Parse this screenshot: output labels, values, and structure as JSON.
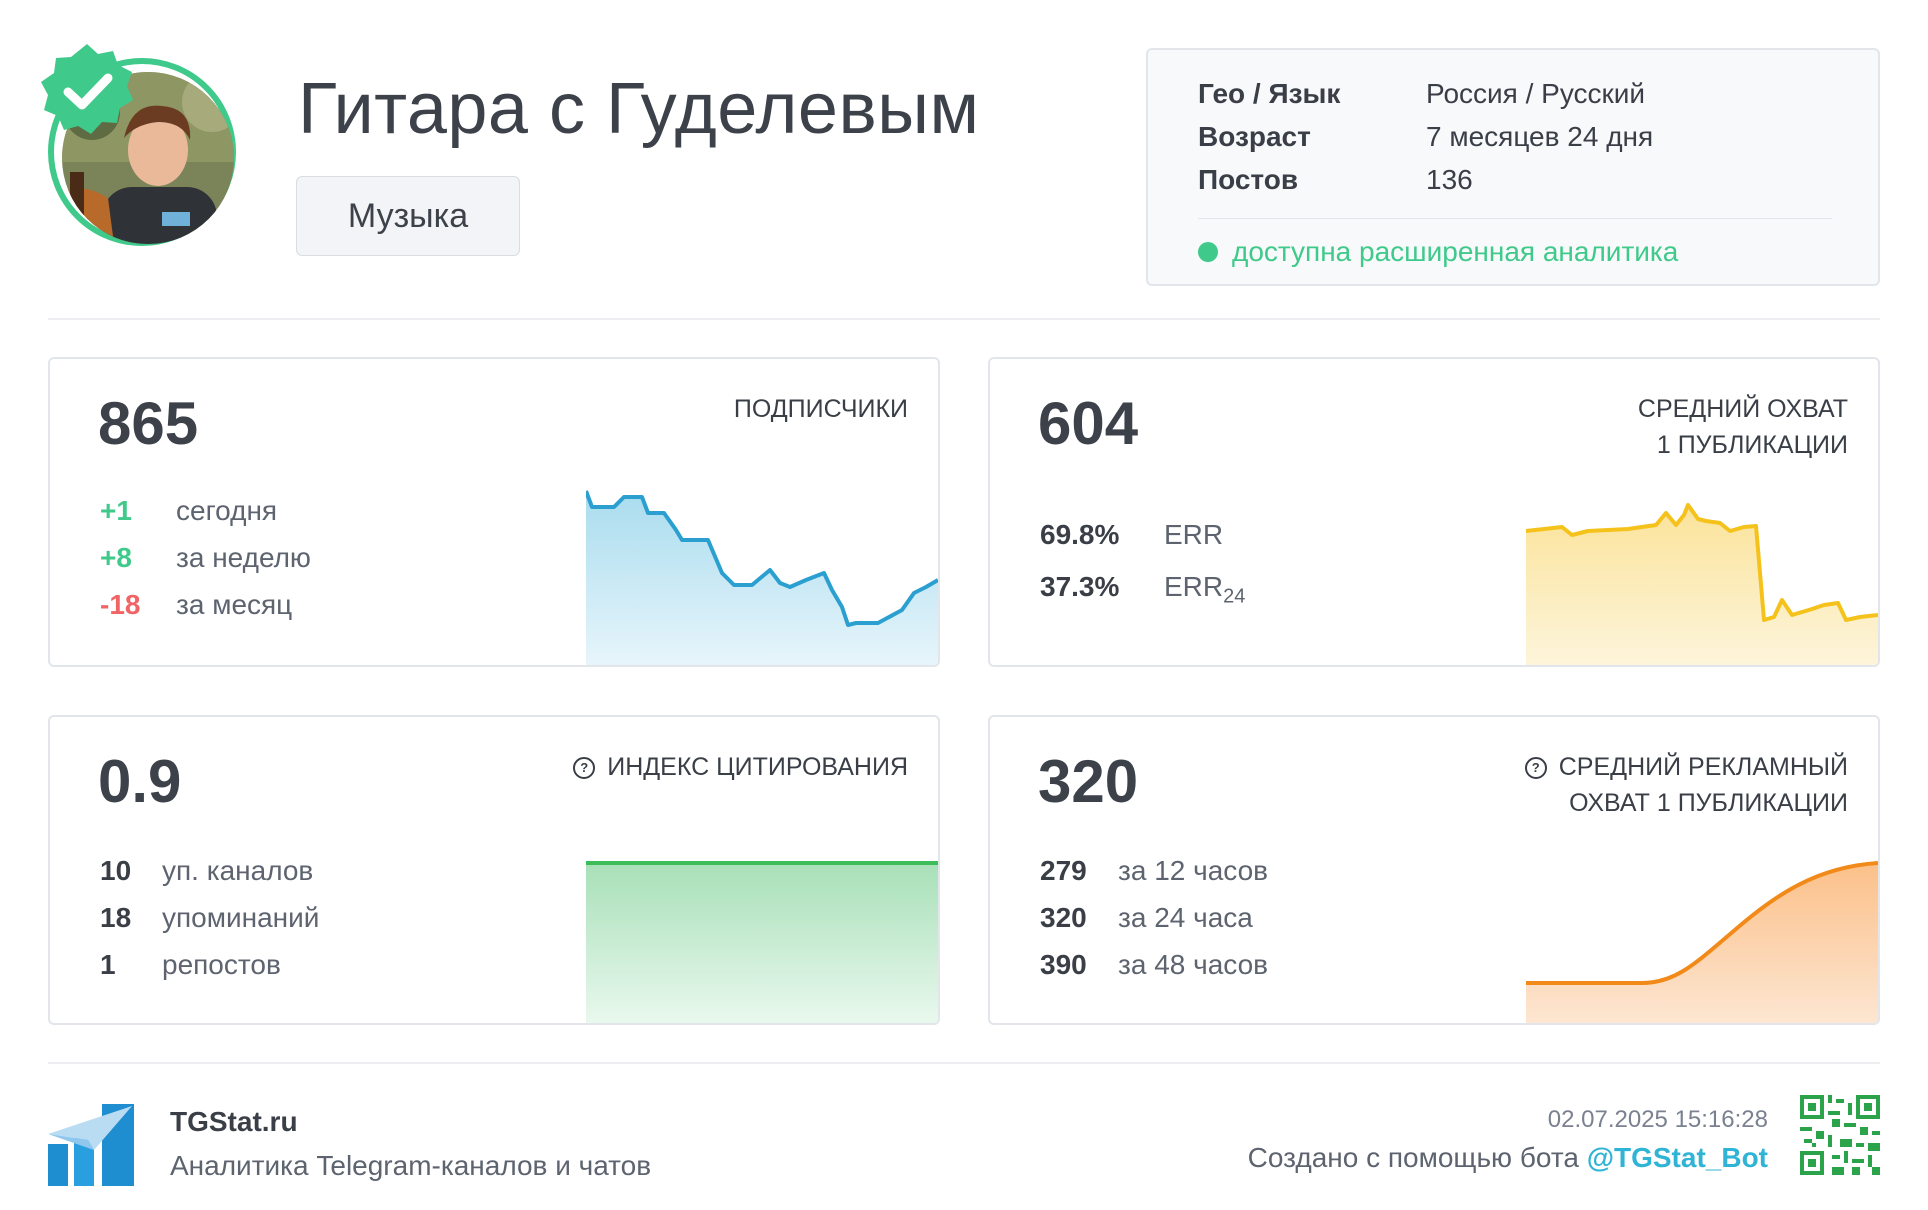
{
  "header": {
    "title": "Гитара с Гуделевым",
    "category": "Музыка"
  },
  "info": {
    "rows": [
      {
        "key": "Гео / Язык",
        "value": "Россия / Русский"
      },
      {
        "key": "Возраст",
        "value": "7 месяцев 24 дня"
      },
      {
        "key": "Постов",
        "value": "136"
      }
    ],
    "analytics": "доступна расширенная аналитика"
  },
  "subscribers": {
    "value": "865",
    "label": "ПОДПИСЧИКИ",
    "today": {
      "n": "+1",
      "t": "сегодня"
    },
    "week": {
      "n": "+8",
      "t": "за неделю"
    },
    "month": {
      "n": "-18",
      "t": "за месяц"
    }
  },
  "reach": {
    "value": "604",
    "label_line1": "СРЕДНИЙ ОХВАТ",
    "label_line2": "1 ПУБЛИКАЦИИ",
    "err": {
      "n": "69.8%",
      "t": "ERR"
    },
    "err24": {
      "n": "37.3%",
      "t": "ERR",
      "sub": "24"
    }
  },
  "citation": {
    "value": "0.9",
    "label": "ИНДЕКС ЦИТИРОВАНИЯ",
    "channels": {
      "n": "10",
      "t": "уп. каналов"
    },
    "mentions": {
      "n": "18",
      "t": "упоминаний"
    },
    "reposts": {
      "n": "1",
      "t": "репостов"
    }
  },
  "ad_reach": {
    "value": "320",
    "label_line1": "СРЕДНИЙ РЕКЛАМНЫЙ",
    "label_line2": "ОХВАТ 1 ПУБЛИКАЦИИ",
    "h12": {
      "n": "279",
      "t": "за 12 часов"
    },
    "h24": {
      "n": "320",
      "t": "за 24 часа"
    },
    "h48": {
      "n": "390",
      "t": "за 48 часов"
    }
  },
  "footer": {
    "brand": "TGStat.ru",
    "subtitle": "Аналитика Telegram-каналов и чатов",
    "timestamp": "02.07.2025 15:16:28",
    "made_by": "Создано с помощью бота ",
    "bot": "@TGStat_Bot"
  },
  "colors": {
    "accent_green": "#3fc98a",
    "negative_red": "#f06466",
    "subscribers_line": "#2a9fd0",
    "reach_line": "#f5c21b",
    "citation_line": "#3cbd5a",
    "ad_reach_line": "#f28a1a",
    "bot_link": "#2fb4d6"
  },
  "icons": [
    "verified-badge-icon",
    "help-circle-icon",
    "tgstat-logo-icon",
    "qr-code-icon"
  ]
}
